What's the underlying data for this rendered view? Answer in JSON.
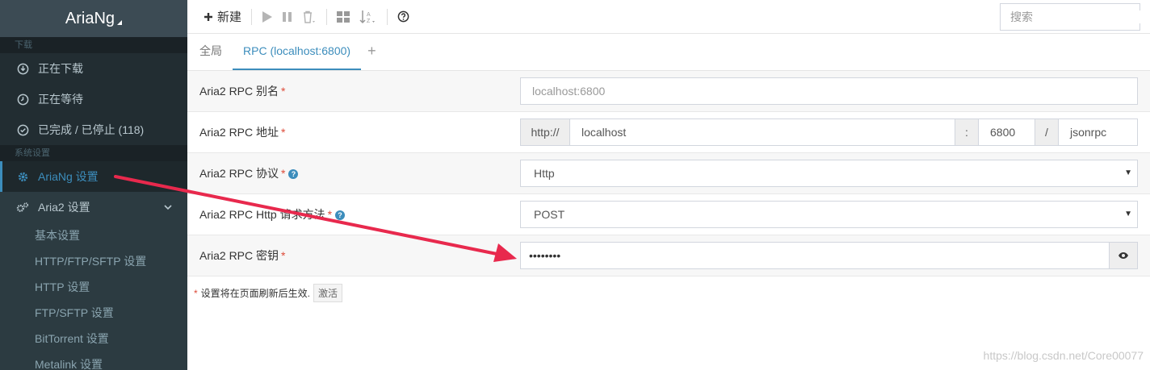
{
  "app": {
    "title": "AriaNg"
  },
  "sidebar": {
    "section_download": "下载",
    "downloading": "正在下载",
    "waiting": "正在等待",
    "stopped": "已完成 / 已停止 (118)",
    "section_settings": "系统设置",
    "ariang_settings": "AriaNg 设置",
    "aria2_settings": "Aria2 设置",
    "sub_items": [
      "基本设置",
      "HTTP/FTP/SFTP 设置",
      "HTTP 设置",
      "FTP/SFTP 设置",
      "BitTorrent 设置",
      "Metalink 设置"
    ]
  },
  "toolbar": {
    "new_label": "新建",
    "search_placeholder": "搜索"
  },
  "tabs": {
    "global": "全局",
    "rpc": "RPC (localhost:6800)",
    "add": "+"
  },
  "form": {
    "alias": {
      "label": "Aria2 RPC 别名",
      "placeholder": "localhost:6800"
    },
    "address": {
      "label": "Aria2 RPC 地址",
      "protocol": "http://",
      "host": "localhost",
      "colon": ":",
      "port": "6800",
      "slash": "/",
      "path": "jsonrpc"
    },
    "protocol": {
      "label": "Aria2 RPC 协议",
      "value": "Http"
    },
    "method": {
      "label": "Aria2 RPC Http 请求方法",
      "value": "POST"
    },
    "secret": {
      "label": "Aria2 RPC 密钥",
      "value": "••••••••"
    }
  },
  "footer": {
    "note": "设置将在页面刷新后生效.",
    "activate": "激活"
  },
  "watermark": "https://blog.csdn.net/Core00077",
  "colors": {
    "accent": "#3c8dbc",
    "sidebar_bg": "#222d32",
    "required": "#dd4b39",
    "arrow": "#e8294d"
  },
  "icons": [
    "download-icon",
    "clock-icon",
    "check-circle-icon",
    "gear-icon",
    "gears-icon",
    "chevron-down-icon",
    "plus-icon",
    "play-icon",
    "pause-icon",
    "trash-icon",
    "grid-icon",
    "sort-icon",
    "question-circle-icon",
    "search-icon",
    "eye-icon"
  ]
}
